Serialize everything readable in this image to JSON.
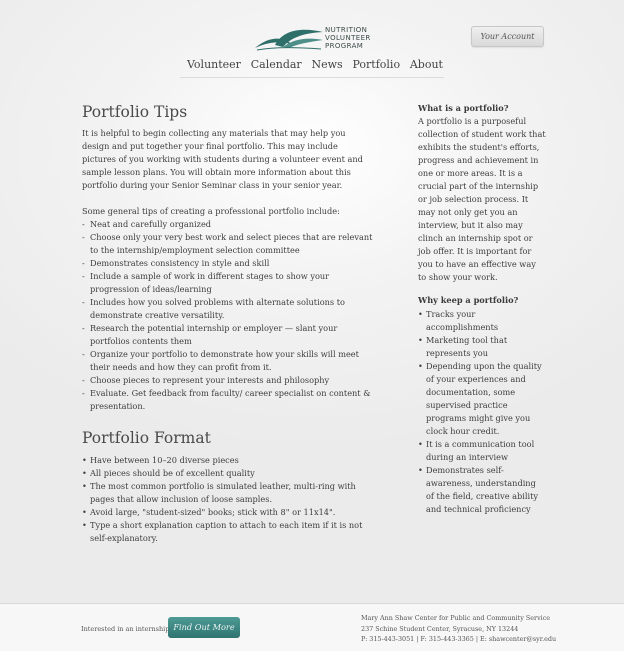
{
  "header": {
    "logo_lines": [
      "NUTRITION",
      "VOLUNTEER",
      "PROGRAM"
    ],
    "account_label": "Your Account",
    "nav": [
      "Volunteer",
      "Calendar",
      "News",
      "Portfolio",
      "About"
    ]
  },
  "main": {
    "title": "Portfolio Tips",
    "intro": "It is helpful to begin collecting any materials that may help you design and put together your final portfolio.  This may include pictures of you working with students during a volunteer event and sample lesson plans.  You will obtain more information about this portfolio during your Senior Seminar class in your senior year.",
    "tips_intro": "Some general tips of creating a professional portfolio include:",
    "tips": [
      "Neat and carefully organized",
      "Choose only your very best work and select pieces that are relevant to the internship/employment selection committee",
      "Demonstrates consistency in style and skill",
      "Include a sample of work in different stages to show your progression of ideas/learning",
      "Includes how you solved problems with alternate solutions to demonstrate creative versatility.",
      "Research the potential internship or employer — slant your portfolios contents them",
      "Organize your portfolio to demonstrate how your skills will meet their needs and how they can profit from it.",
      "Choose pieces to represent your interests and philosophy",
      "Evaluate.  Get feedback from faculty/ career specialist on content & presentation."
    ],
    "format_title": "Portfolio Format",
    "format_items": [
      "Have between 10–20 diverse pieces",
      "All pieces should be of excellent quality",
      "The most common portfolio is simulated leather, multi-ring with pages that allow inclusion of loose samples.",
      "Avoid large, \"student-sized\" books; stick with 8\" or 11x14\".",
      "Type a short explanation caption to attach to each item if it is not self-explanatory."
    ]
  },
  "sidebar": {
    "what_title": "What is a portfolio?",
    "what_text": "A portfolio is a purposeful collection of student work that exhibits the student's efforts, progress and achievement in one or more areas.  It is a crucial part of the internship or job selection process.  It may not only get you an interview, but it also may clinch an internship spot or job offer.  It is important for you to have an effective way to show your work.",
    "why_title": "Why keep a portfolio?",
    "why_items": [
      "Tracks your accomplishments",
      "Marketing tool that represents you",
      "Depending upon the quality of your experiences and documentation, some supervised practice programs might give you clock hour credit.",
      "It is a communication tool during an interview",
      "Demonstrates self-awareness, understanding of the field, creative ability and technical proficiency"
    ]
  },
  "footer": {
    "question": "Interested in an internship?",
    "button": "Find Out More",
    "address_lines": [
      "Mary Ann Shaw Center for Public and Community Service",
      "237 Schine Student Center, Syracuse, NY 13244",
      "P: 315-443-3051  |  F: 315-443-3365  |  E: shawcenter@syr.edu"
    ]
  },
  "colors": {
    "brand_teal": "#2f7470",
    "text": "#3d3d3d"
  }
}
